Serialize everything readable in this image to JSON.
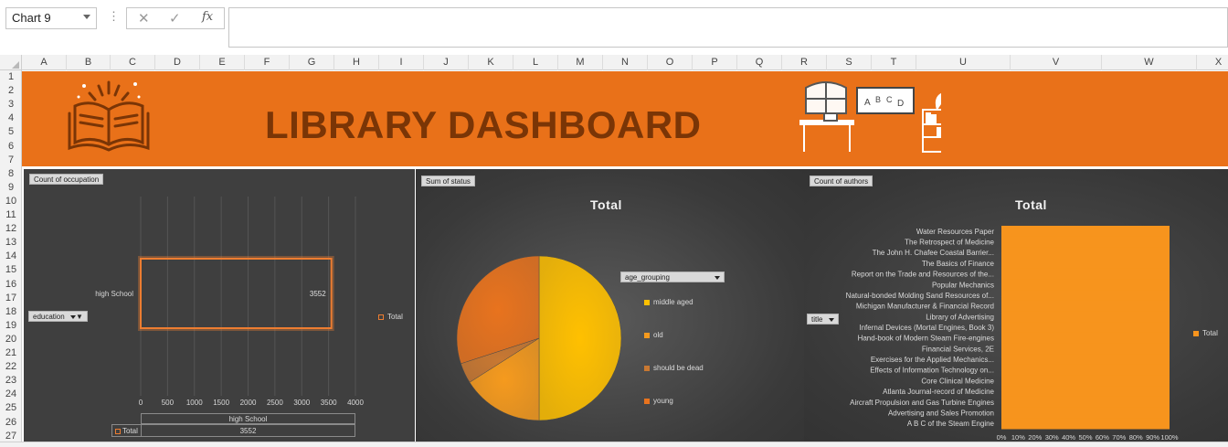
{
  "namebox": {
    "value": "Chart 9"
  },
  "formula": {
    "cancel_icon": "x-icon",
    "enter_icon": "check-icon",
    "fx_label": "fx",
    "value": ""
  },
  "columns": [
    "A",
    "B",
    "C",
    "D",
    "E",
    "F",
    "G",
    "H",
    "I",
    "J",
    "K",
    "L",
    "M",
    "N",
    "O",
    "P",
    "Q",
    "R",
    "S",
    "T",
    "U",
    "V",
    "W",
    "X"
  ],
  "rows": [
    "1",
    "2",
    "3",
    "4",
    "5",
    "6",
    "7",
    "8",
    "9",
    "10",
    "11",
    "12",
    "13",
    "14",
    "15",
    "16",
    "17",
    "18",
    "19",
    "20",
    "21",
    "22",
    "23",
    "24",
    "25",
    "26",
    "27"
  ],
  "banner": {
    "title": "LIBRARY DASHBOARD",
    "color": "#e97119",
    "title_color": "#7a3506"
  },
  "panel1": {
    "value_button": "Count of occupation",
    "axis_button": "education",
    "legend": "Total",
    "table_header": "high School",
    "table_row_label": "Total",
    "table_row_value": "3552"
  },
  "panel2": {
    "value_button": "Sum of status",
    "title": "Total",
    "legend_button": "age_grouping"
  },
  "panel3": {
    "value_button": "Count of authors",
    "title": "Total",
    "axis_button": "title",
    "legend": "Total"
  },
  "chart_data": [
    {
      "type": "bar",
      "orientation": "horizontal",
      "categories": [
        "high School"
      ],
      "series": [
        {
          "name": "Total",
          "values": [
            3552
          ]
        }
      ],
      "xlim": [
        0,
        4000
      ],
      "xticks": [
        "0",
        "500",
        "1000",
        "1500",
        "2000",
        "2500",
        "3000",
        "3500",
        "4000"
      ],
      "data_labels": [
        "3552"
      ],
      "color": "#ed7d31",
      "grid": true,
      "legend_position": "right"
    },
    {
      "type": "pie",
      "title": "Total",
      "categories": [
        "middle aged",
        "old",
        "should be dead",
        "young"
      ],
      "values": [
        50,
        16,
        4,
        30
      ],
      "colors": [
        "#ffc000",
        "#f59a1e",
        "#c87832",
        "#e8731e"
      ],
      "legend_position": "right"
    },
    {
      "type": "bar",
      "orientation": "horizontal",
      "stacked": "100%",
      "title": "Total",
      "categories": [
        "Water Resources Paper",
        "The Retrospect of Medicine",
        "The John H. Chafee Coastal Barrier...",
        "The Basics of Finance",
        "Report on the Trade and Resources of the...",
        "Popular Mechanics",
        "Natural-bonded Molding Sand Resources of...",
        "Michigan Manufacturer & Financial Record",
        "Library of Advertising",
        "Infernal Devices (Mortal Engines, Book 3)",
        "Hand-book of Modern Steam Fire-engines",
        "Financial Services, 2E",
        "Exercises for the Applied Mechanics...",
        "Effects of Information Technology on...",
        "Core Clinical Medicine",
        "Atlanta Journal-record of Medicine",
        "Aircraft Propulsion and Gas Turbine Engines",
        "Advertising and Sales Promotion",
        "A B C of the Steam Engine"
      ],
      "series": [
        {
          "name": "Total",
          "values": [
            100,
            100,
            100,
            100,
            100,
            100,
            100,
            100,
            100,
            100,
            100,
            100,
            100,
            100,
            100,
            100,
            100,
            100,
            100
          ]
        }
      ],
      "xlim": [
        0,
        100
      ],
      "xticks": [
        "0%",
        "10%",
        "20%",
        "30%",
        "40%",
        "50%",
        "60%",
        "70%",
        "80%",
        "90%",
        "100%"
      ],
      "color": "#f7941d",
      "legend_position": "right"
    }
  ]
}
